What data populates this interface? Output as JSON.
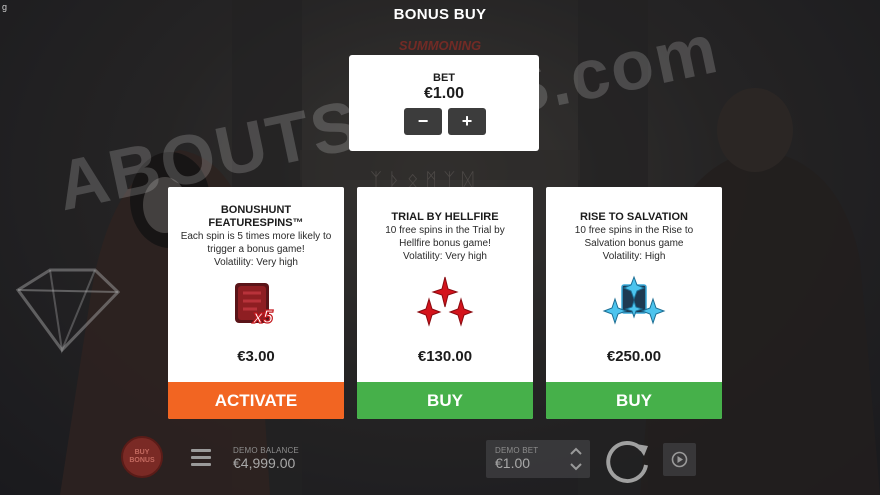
{
  "corner_mark": "g",
  "title": "BONUS BUY",
  "logo_text": "SUMMONING",
  "watermark": "ABOUTSLOTS.com",
  "bet": {
    "label": "BET",
    "value": "€1.00",
    "minus_label": "−",
    "plus_label": "+"
  },
  "cards": [
    {
      "title": "BONUSHUNT FEATURESPINS™",
      "description": "Each spin is 5 times more likely to trigger a bonus game!",
      "volatility": "Volatility: Very high",
      "icon": "x5-multiplier-icon",
      "icon_text": "x5",
      "price": "€3.00",
      "button_label": "ACTIVATE",
      "button_color": "#f26522"
    },
    {
      "title": "TRIAL BY HELLFIRE",
      "description": "10 free spins in the Trial by Hellfire bonus game!",
      "volatility": "Volatility: Very high",
      "icon": "red-shuriken-icon",
      "price": "€130.00",
      "button_label": "BUY",
      "button_color": "#46b04a"
    },
    {
      "title": "RISE TO SALVATION",
      "description": "10 free spins in the Rise to Salvation bonus game",
      "volatility": "Volatility: High",
      "icon": "blue-shuriken-icon",
      "price": "€250.00",
      "button_label": "BUY",
      "button_color": "#46b04a"
    }
  ],
  "bottom_bar": {
    "buy_bonus_label": "BUY BONUS",
    "demo_balance_label": "DEMO BALANCE",
    "demo_balance_value": "€4,999.00",
    "demo_bet_label": "DEMO BET",
    "demo_bet_value": "€1.00"
  },
  "colors": {
    "activate": "#f26522",
    "buy": "#46b04a",
    "panel": "#ffffff",
    "stepper": "#3c3c3c"
  }
}
